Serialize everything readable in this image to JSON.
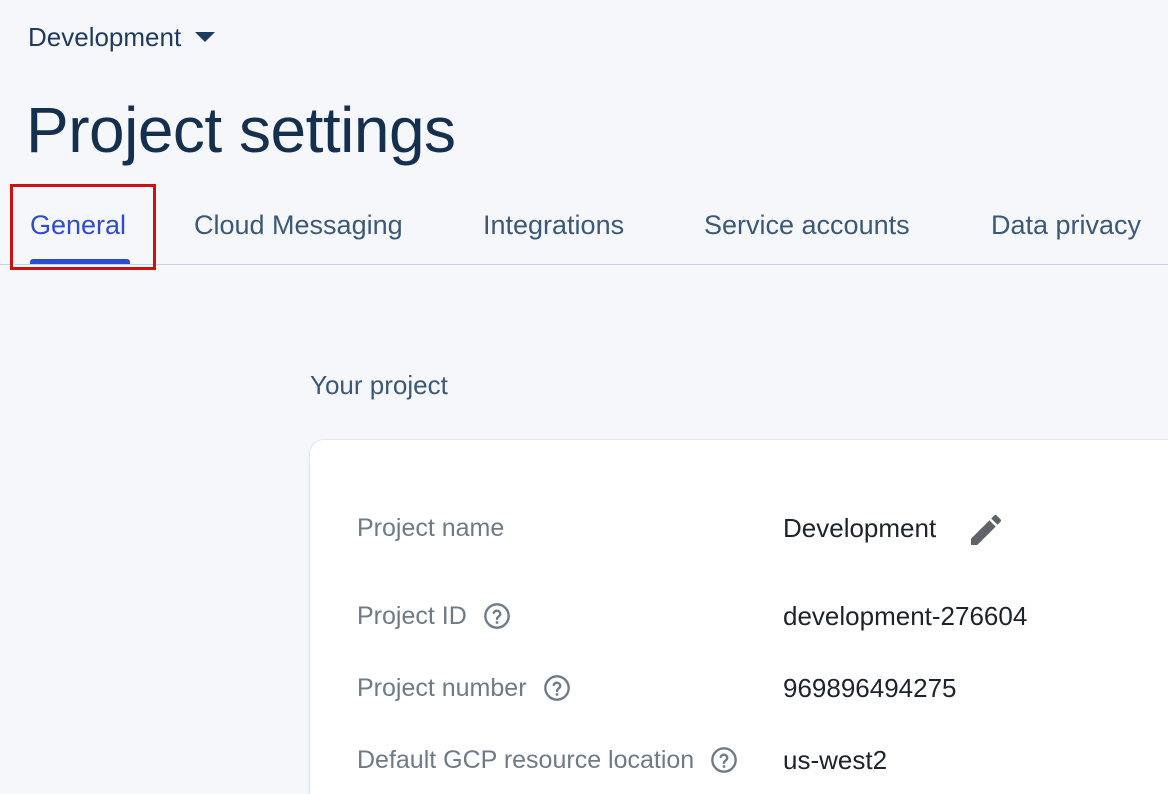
{
  "project_switcher": {
    "label": "Development"
  },
  "page_title": "Project settings",
  "tabs": [
    {
      "label": "General",
      "active": true
    },
    {
      "label": "Cloud Messaging",
      "active": false
    },
    {
      "label": "Integrations",
      "active": false
    },
    {
      "label": "Service accounts",
      "active": false
    },
    {
      "label": "Data privacy",
      "active": false
    }
  ],
  "section_heading": "Your project",
  "fields": [
    {
      "label": "Project name",
      "value": "Development",
      "help": false,
      "editable": true
    },
    {
      "label": "Project ID",
      "value": "development-276604",
      "help": true
    },
    {
      "label": "Project number",
      "value": "969896494275",
      "help": true
    },
    {
      "label": "Default GCP resource location",
      "value": "us-west2",
      "help": true
    }
  ],
  "colors": {
    "accent": "#2e4ad8",
    "highlight": "#cc1111",
    "title": "#15304f",
    "background": "#f5f7fa"
  },
  "icons": {
    "project_caret": "caret-down-icon",
    "edit": "pencil-icon",
    "help": "help-circle-icon"
  }
}
